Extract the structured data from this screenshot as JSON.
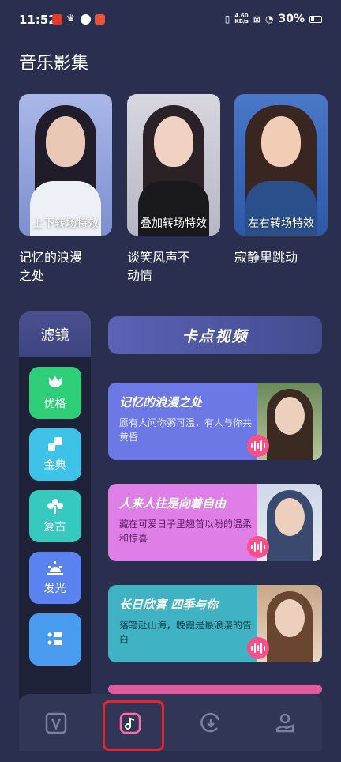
{
  "status_bar": {
    "time": "11:52",
    "speed_value": "4.60",
    "speed_unit": "KB/s",
    "battery": "30%"
  },
  "page_title": "音乐影集",
  "top_cards": [
    {
      "effect": "上下转场特效",
      "title": "记忆的浪漫之处"
    },
    {
      "effect": "叠加转场特效",
      "title": "谈笑风声不动情"
    },
    {
      "effect": "左右转场特效",
      "title": "寂静里跳动"
    }
  ],
  "filters": {
    "title": "滤镜",
    "items": [
      {
        "label": "优格",
        "icon": "tulip-icon",
        "color": "#2fcf7a"
      },
      {
        "label": "金典",
        "icon": "squares-icon",
        "color": "#3ec2e8"
      },
      {
        "label": "复古",
        "icon": "flower-icon",
        "color": "#35c9c0"
      },
      {
        "label": "发光",
        "icon": "sunrise-icon",
        "color": "#5a83f0"
      },
      {
        "label": "",
        "icon": "list-icon",
        "color": "#4a9cf0"
      }
    ]
  },
  "kadian": {
    "title": "卡点视频",
    "cards": [
      {
        "title": "记忆的浪漫之处",
        "desc": "愿有人问你粥可温，有人与你共黄昏",
        "bg": "#6b78e6",
        "desc_color": "#e3e6ff"
      },
      {
        "title": "人来人往是向着自由",
        "desc": "藏在可爱日子里翘首以盼的温柔和惊喜",
        "bg": "#e07ee8",
        "desc_color": "#5a1d63"
      },
      {
        "title": "长日欣喜 四季与你",
        "desc": "落笔赴山海，晚霞是最浪漫的告白",
        "bg": "#3fb2c4",
        "desc_color": "#0f3d48"
      }
    ]
  },
  "nav": {
    "items": [
      "v-icon",
      "music-note-icon",
      "clock-download-icon",
      "user-hand-icon"
    ],
    "active_index": 1
  }
}
